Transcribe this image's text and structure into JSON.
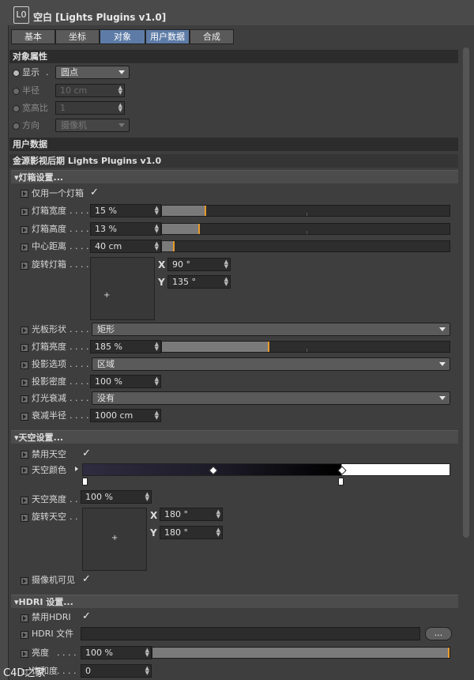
{
  "window": {
    "title": "空白 [Lights Plugins v1.0]",
    "icon": "null-object-icon"
  },
  "tabs": [
    {
      "label": "基本",
      "active": false
    },
    {
      "label": "坐标",
      "active": false
    },
    {
      "label": "对象",
      "active": true
    },
    {
      "label": "用户数据",
      "active": true
    },
    {
      "label": "合成",
      "active": false
    }
  ],
  "object_props": {
    "section": "对象属性",
    "display": {
      "label": "显示",
      "value": "圆点"
    },
    "radius": {
      "label": "半径",
      "value": "10 cm"
    },
    "aspect": {
      "label": "宽高比",
      "value": "1"
    },
    "orientation": {
      "label": "方向",
      "value": "摄像机"
    }
  },
  "user_data": {
    "section": "用户数据",
    "plugin_title": "金源影视后期 Lights Plugins v1.0"
  },
  "lightbox": {
    "group": "▾灯箱设置...",
    "only_one": {
      "label": "仅用一个灯箱",
      "checked": "✓"
    },
    "width": {
      "label": "灯箱宽度",
      "value": "15 %",
      "level": 0.15
    },
    "height": {
      "label": "灯箱高度",
      "value": "13 %",
      "level": 0.13
    },
    "center": {
      "label": "中心距离",
      "value": "40 cm",
      "level": 0.04
    },
    "rotate": {
      "label": "旋转灯箱",
      "x": "90 °",
      "y": "135 °"
    },
    "shape": {
      "label": "光板形状",
      "value": "矩形"
    },
    "brightness": {
      "label": "灯箱亮度",
      "value": "185 %",
      "level": 0.37
    },
    "projection": {
      "label": "投影选项",
      "value": "区域"
    },
    "density": {
      "label": "投影密度",
      "value": "100 %"
    },
    "falloff": {
      "label": "灯光衰减",
      "value": "没有"
    },
    "falloff_radius": {
      "label": "衰减半径",
      "value": "1000 cm"
    }
  },
  "sky": {
    "group": "▾天空设置...",
    "disable": {
      "label": "禁用天空",
      "checked": "✓"
    },
    "color": {
      "label": "天空颜色"
    },
    "brightness": {
      "label": "天空亮度",
      "value": "100 %"
    },
    "rotate": {
      "label": "旋转天空",
      "x": "180 °",
      "y": "180 °"
    },
    "camera_visible": {
      "label": "摄像机可见",
      "checked": "✓"
    }
  },
  "hdri": {
    "group": "▾HDRI 设置...",
    "disable": {
      "label": "禁用HDRI",
      "checked": "✓"
    },
    "file": {
      "label": "HDRI 文件",
      "button": "..."
    },
    "brightness": {
      "label": "亮度",
      "value": "100 %",
      "level": 1.0
    },
    "saturation": {
      "label": "饱和度",
      "value": "0"
    }
  },
  "dots": ". . . . .",
  "xy": {
    "x": "X",
    "y": "Y"
  },
  "watermark": "C4D之家",
  "colors": {
    "accent": "#e89a2a",
    "tab_active": "#5d7ba6",
    "panel": "#3e3e3e"
  }
}
